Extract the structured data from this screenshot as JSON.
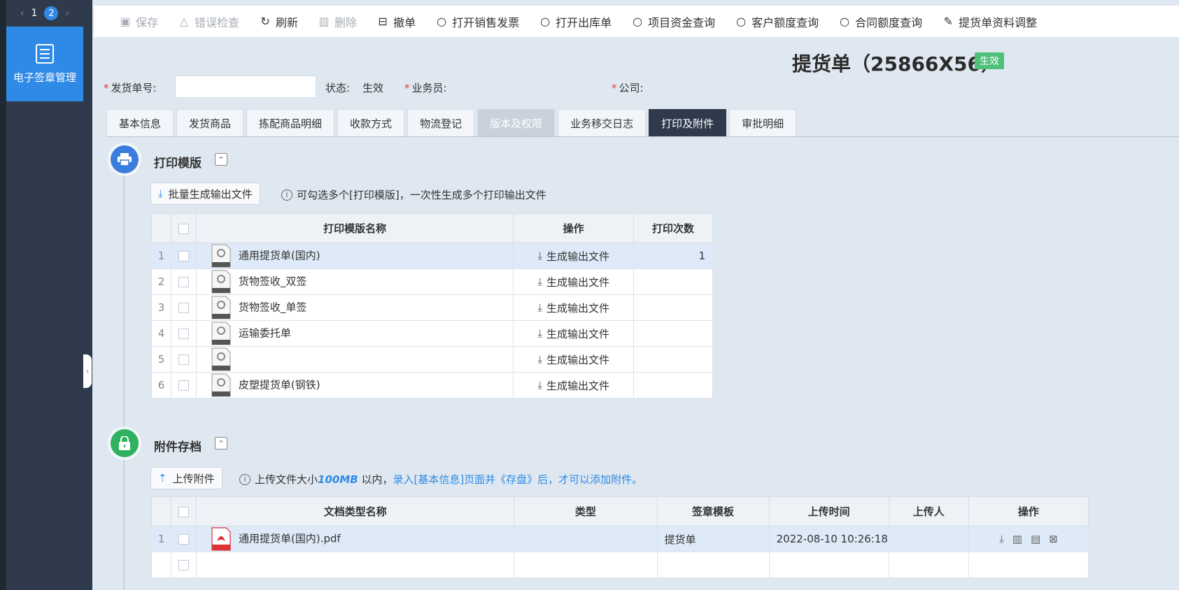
{
  "pager": {
    "prev": "‹",
    "page1": "1",
    "page2": "2",
    "next": "›"
  },
  "sidebar": {
    "active_item": "电子签章管理",
    "icon": "document-list-icon"
  },
  "toolbar": {
    "items": [
      {
        "label": "保存",
        "icon": "save-icon",
        "disabled": true
      },
      {
        "label": "错误检查",
        "icon": "warning-icon",
        "disabled": true
      },
      {
        "label": "刷新",
        "icon": "refresh-icon",
        "disabled": false
      },
      {
        "label": "删除",
        "icon": "trash-icon",
        "disabled": true
      },
      {
        "label": "撤单",
        "icon": "withdraw-icon",
        "disabled": false
      },
      {
        "label": "打开销售发票",
        "icon": "search-icon",
        "disabled": false
      },
      {
        "label": "打开出库单",
        "icon": "search-icon",
        "disabled": false
      },
      {
        "label": "项目资金查询",
        "icon": "search-icon",
        "disabled": false
      },
      {
        "label": "客户额度查询",
        "icon": "search-icon",
        "disabled": false
      },
      {
        "label": "合同额度查询",
        "icon": "search-icon",
        "disabled": false
      },
      {
        "label": "提货单资料调整",
        "icon": "edit-icon",
        "disabled": false
      }
    ]
  },
  "header": {
    "title": "提货单（25866X56）",
    "status": "生效"
  },
  "form": {
    "order_no_label": "发货单号:",
    "order_no_value": "",
    "status_label": "状态:",
    "status_value": "生效",
    "salesman_label": "业务员:",
    "company_label": "公司:"
  },
  "tabs": [
    {
      "label": "基本信息",
      "state": "normal"
    },
    {
      "label": "发货商品",
      "state": "normal"
    },
    {
      "label": "拣配商品明细",
      "state": "normal"
    },
    {
      "label": "收款方式",
      "state": "normal"
    },
    {
      "label": "物流登记",
      "state": "normal"
    },
    {
      "label": "版本及权限",
      "state": "disabled"
    },
    {
      "label": "业务移交日志",
      "state": "normal"
    },
    {
      "label": "打印及附件",
      "state": "active"
    },
    {
      "label": "审批明细",
      "state": "normal"
    }
  ],
  "print_section": {
    "title": "打印模版",
    "batch_button": "批量生成输出文件",
    "hint": "可勾选多个[打印模版]，一次性生成多个打印输出文件",
    "columns": [
      "打印模版名称",
      "操作",
      "打印次数"
    ],
    "action_label": "生成输出文件",
    "rows": [
      {
        "no": "1",
        "name": "通用提货单(国内)",
        "count": "1"
      },
      {
        "no": "2",
        "name": "货物签收_双签",
        "count": ""
      },
      {
        "no": "3",
        "name": "货物签收_单签",
        "count": ""
      },
      {
        "no": "4",
        "name": "运输委托单",
        "count": ""
      },
      {
        "no": "5",
        "name": "",
        "count": ""
      },
      {
        "no": "6",
        "name": "皮塑提货单(钢铁)",
        "count": ""
      }
    ],
    "file_icon_label": "system"
  },
  "attach_section": {
    "title": "附件存档",
    "upload_button": "上传附件",
    "hint_pre": "上传文件大小",
    "hint_size": "100MB",
    "hint_mid": " 以内，",
    "hint_link": "录入[基本信息]页面并《存盘》后，才可以添加附件。",
    "columns": [
      "文档类型名称",
      "类型",
      "签章模板",
      "上传时间",
      "上传人",
      "操作"
    ],
    "rows": [
      {
        "no": "1",
        "name": "通用提货单(国内).pdf",
        "type": "",
        "template": "提货单",
        "time": "2022-08-10 10:26:18",
        "uploader": ""
      }
    ],
    "pdf_label": "PDF"
  }
}
